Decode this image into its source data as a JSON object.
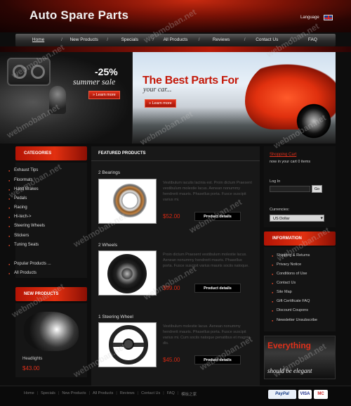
{
  "header": {
    "logo": "Auto Spare Parts",
    "language_label": "Language"
  },
  "nav": {
    "items": [
      "Home",
      "New Products",
      "Specials",
      "All Products",
      "Reviews",
      "Contact Us",
      "FAQ"
    ]
  },
  "banners": {
    "sale_percent": "-25%",
    "sale_text": "summer sale",
    "sale_button": "» Learn more",
    "parts_title": "The Best Parts For",
    "parts_subtitle": "your car...",
    "parts_button": "» Learn more"
  },
  "categories": {
    "title": "CATEGORIES",
    "items": [
      "Exhaust Tips",
      "Floormats",
      "Hand Brakes",
      "Pedals",
      "Racing",
      "Hi-tech->",
      "Steering Wheels",
      "Stickers",
      "Tuning Seats"
    ],
    "extra": [
      "Popular Products ...",
      "All Products"
    ]
  },
  "new_products": {
    "title": "NEW PRODUCTS",
    "item_name": "Headlights",
    "item_price": "$43.00"
  },
  "featured": {
    "title": "FEATURED PRODUCTS",
    "detail_label": "Product details",
    "products": [
      {
        "name": "2 Bearings",
        "desc": "Vestibulum iaculis lacinia est. Proin dictum Praesent vestibulum molestie lacus. Aenean nonummy hendrerit mauris. Phasellus porta. Fusce suscipit varius mi.",
        "price": "$52.00"
      },
      {
        "name": "2 Wheels",
        "desc": "Proin dictum Praesent vestibulum molestie lacus. Aenean nonummy hendrerit mauris. Phasellus porta. Fusce suscipit varius mauris sociis natoque.",
        "price": "$99.00"
      },
      {
        "name": "1 Steering Wheel",
        "desc": "Vestibulum molestie lacus. Aenean nonummy hendrerit mauris. Phasellus porta. Fusce suscipit varius mi. Cum sociis natoque penatibus et magnis dis.",
        "price": "$45.00"
      }
    ]
  },
  "cart": {
    "title": "Shopping Cart",
    "text": "now in your cart 0 items",
    "login_label": "Log In",
    "go_label": "Go",
    "currencies_label": "Currencies:",
    "currency_selected": "US Dollar"
  },
  "information": {
    "title": "INFORMATION",
    "items": [
      "Shipping & Returns",
      "Privacy Notice",
      "Conditions of Use",
      "Contact Us",
      "Site Map",
      "Gift Certificate FAQ",
      "Discount Coupons",
      "Newsletter Unsubscribe"
    ]
  },
  "promo": {
    "headline": "Everything",
    "tagline": "should be elegant"
  },
  "footer": {
    "links": [
      "Home",
      "Specials",
      "New Products",
      "All Products",
      "Reviews",
      "Contact Us",
      "FAQ",
      "模板之家"
    ],
    "payments": [
      "PayPal",
      "VISA",
      "MC"
    ]
  },
  "watermark": "webmoban.net",
  "colors": {
    "accent": "#e0301a",
    "background": "#0d0d0d"
  }
}
